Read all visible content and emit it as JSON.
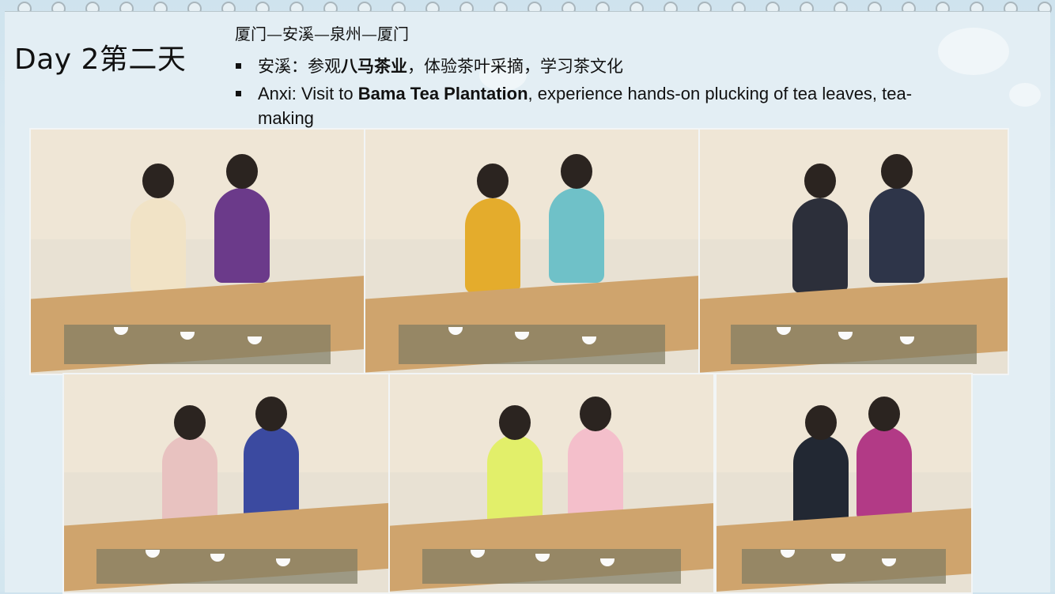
{
  "slide": {
    "title": "Day 2第二天",
    "route": "厦门—安溪—泉州—厦门",
    "bullet_cn": {
      "prefix": "安溪：参观",
      "bold": "八马茶业",
      "suffix": "，体验茶叶采摘，学习茶文化"
    },
    "bullet_en": {
      "prefix": "Anxi: Visit to ",
      "bold": "Bama Tea Plantation",
      "suffix": ", experience hands-on plucking of tea leaves, tea-making"
    }
  },
  "photos": [
    {
      "name": "tea-class-photo-1",
      "shirt1": "#f1e3c6",
      "shirt2": "#6b3a8a"
    },
    {
      "name": "tea-class-photo-2",
      "shirt1": "#e4ac2c",
      "shirt2": "#6fc1c8"
    },
    {
      "name": "tea-class-photo-3",
      "shirt1": "#2c2f3a",
      "shirt2": "#2e3549"
    },
    {
      "name": "tea-class-photo-4",
      "shirt1": "#e8c2c0",
      "shirt2": "#3b4aa0"
    },
    {
      "name": "tea-class-photo-5",
      "shirt1": "#e2ef6a",
      "shirt2": "#f4bfcb"
    },
    {
      "name": "tea-class-photo-6",
      "shirt1": "#222833",
      "shirt2": "#b23a86"
    }
  ]
}
